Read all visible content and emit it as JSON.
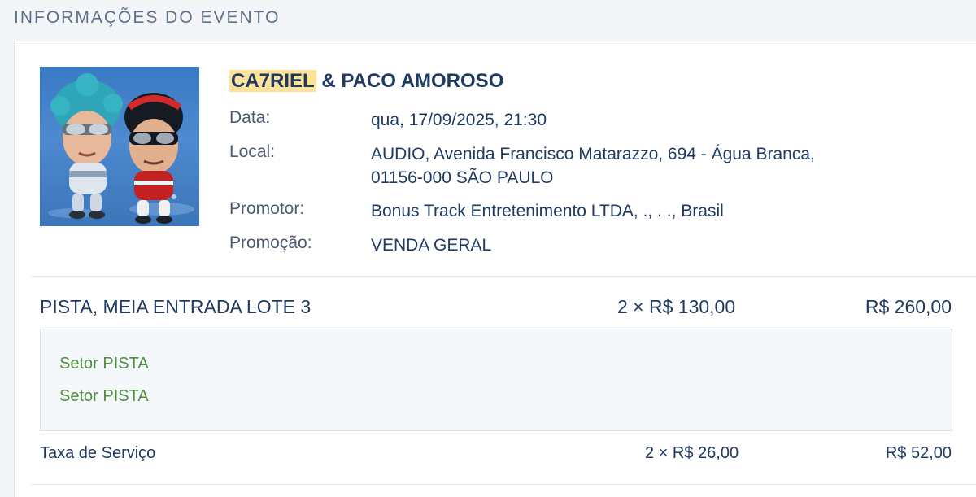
{
  "header": {
    "title": "INFORMAÇÕES DO EVENTO"
  },
  "event": {
    "title_highlight": "CA7RIEL",
    "title_rest": " & PACO AMOROSO",
    "image_alt": "event artwork with two cartoon characters",
    "details": [
      {
        "label": "Data:",
        "value": "qua, 17/09/2025, 21:30"
      },
      {
        "label": "Local:",
        "value_line1": "AUDIO, Avenida Francisco Matarazzo, 694 - Água Branca,",
        "value_line2": "01156-000 SÃO PAULO"
      },
      {
        "label": "Promotor:",
        "value": "Bonus Track Entretenimento LTDA, ., . ., Brasil"
      },
      {
        "label": "Promoção:",
        "value": "VENDA GERAL"
      }
    ]
  },
  "ticket": {
    "name": "PISTA, MEIA ENTRADA LOTE 3",
    "qty_price": "2 × R$ 130,00",
    "total": "R$ 260,00",
    "sectors": [
      "Setor PISTA",
      "Setor PISTA"
    ]
  },
  "fee": {
    "name": "Taxa de Serviço",
    "qty_price": "2 × R$ 26,00",
    "total": "R$ 52,00"
  },
  "colors": {
    "heading": "#5e7089",
    "text_dark_blue": "#1f3a63",
    "highlight": "#fde39a",
    "sector_green": "#4f8f3f",
    "image_sky_blue": "#4d8ad0"
  }
}
